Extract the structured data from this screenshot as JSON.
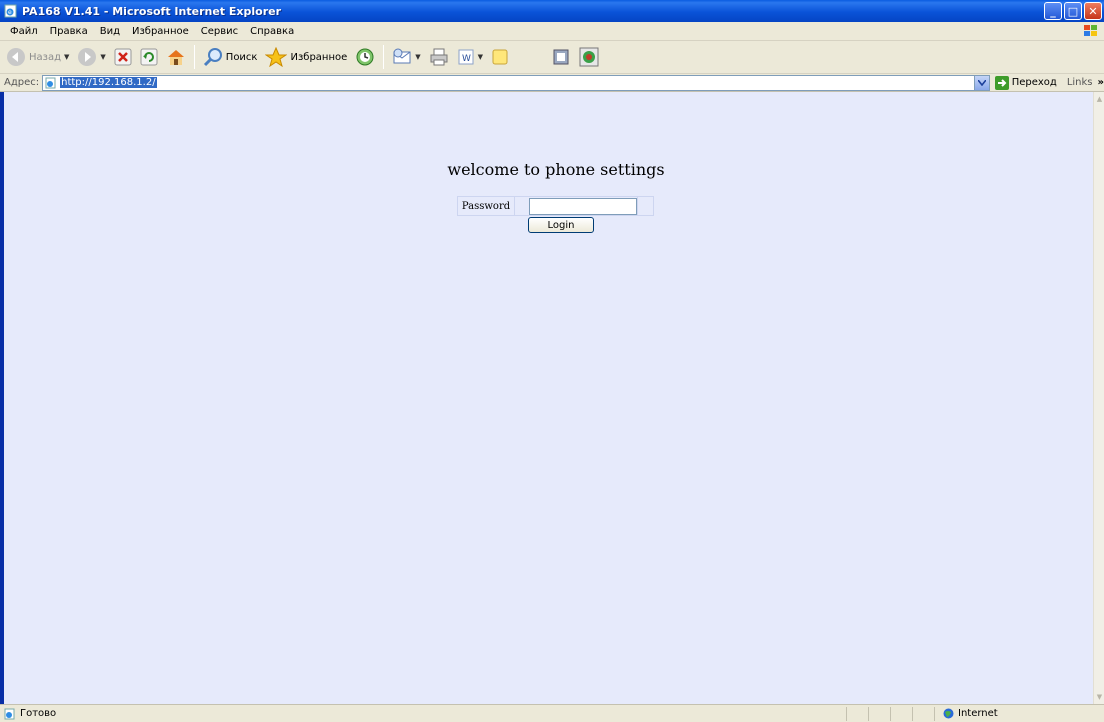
{
  "window": {
    "title": "PA168 V1.41 - Microsoft Internet Explorer"
  },
  "menu": {
    "items": [
      "Файл",
      "Правка",
      "Вид",
      "Избранное",
      "Сервис",
      "Справка"
    ]
  },
  "toolbar": {
    "back_label": "Назад",
    "search_label": "Поиск",
    "favorites_label": "Избранное"
  },
  "address": {
    "label": "Адрес:",
    "url": "http://192.168.1.2/",
    "go_label": "Переход",
    "links_label": "Links"
  },
  "page": {
    "heading": "welcome to phone settings",
    "password_label": "Password",
    "password_value": "",
    "login_label": "Login"
  },
  "status": {
    "text": "Готово",
    "zone": "Internet"
  },
  "colors": {
    "titlebar": "#0a53d8",
    "content_bg": "#e6eafb",
    "chrome": "#ece9d8",
    "selection": "#316ac5"
  }
}
